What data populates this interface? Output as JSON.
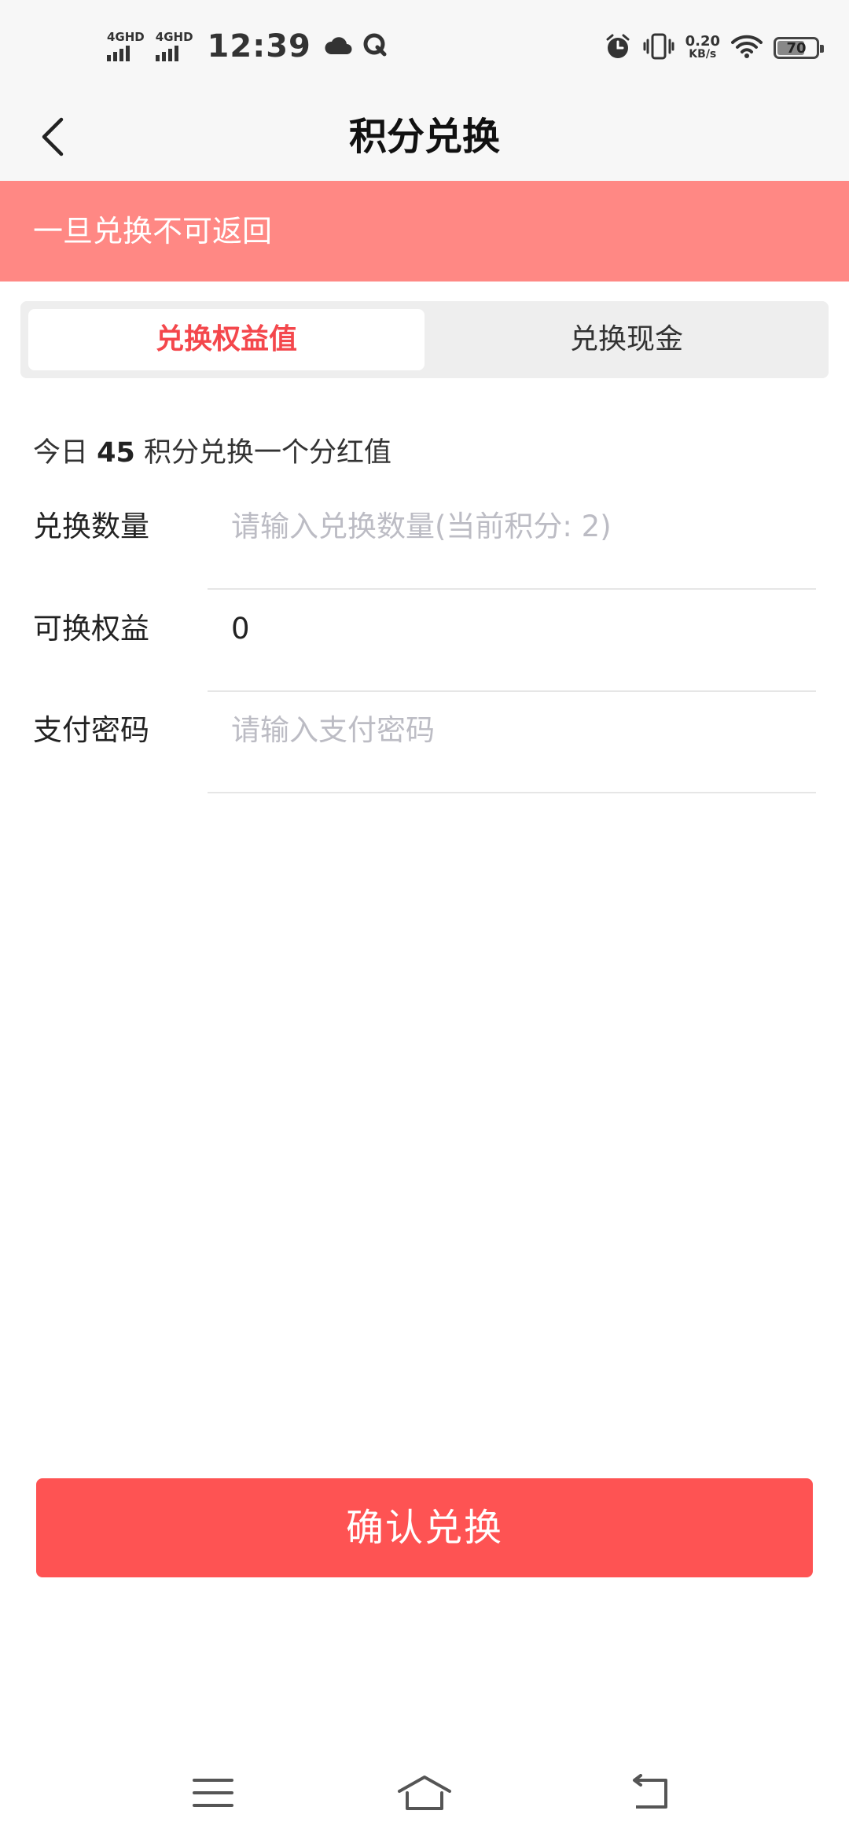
{
  "status_bar": {
    "sim1": "4GHD",
    "sim2": "4GHD",
    "time": "12:39",
    "speed_value": "0.20",
    "speed_unit": "KB/s",
    "battery_level": "70",
    "battery_fraction": 0.7,
    "icons": [
      "signal-icon",
      "signal-icon",
      "weather-cloud-icon",
      "app-q-icon",
      "alarm-icon",
      "vibrate-icon",
      "wifi-icon",
      "battery-icon"
    ]
  },
  "header": {
    "title": "积分兑换",
    "back_icon": "back-arrow-icon"
  },
  "notice": {
    "text": "一旦兑换不可返回"
  },
  "tabs": [
    {
      "label": "兑换权益值",
      "active": true
    },
    {
      "label": "兑换现金",
      "active": false
    }
  ],
  "rate": {
    "prefix": "今日",
    "points": "45",
    "suffix": "积分兑换一个分红值"
  },
  "form": {
    "quantity": {
      "label": "兑换数量",
      "placeholder": "请输入兑换数量(当前积分: 2)",
      "value": ""
    },
    "equity": {
      "label": "可换权益",
      "value": "0"
    },
    "password": {
      "label": "支付密码",
      "placeholder": "请输入支付密码",
      "value": ""
    }
  },
  "confirm_button": {
    "label": "确认兑换"
  },
  "colors": {
    "accent": "#fe5353",
    "notice_bg": "#ff8884",
    "tab_active_text": "#f4474c",
    "placeholder": "#bcbcc4"
  },
  "system_nav": [
    "menu-icon",
    "home-icon",
    "back-icon"
  ]
}
